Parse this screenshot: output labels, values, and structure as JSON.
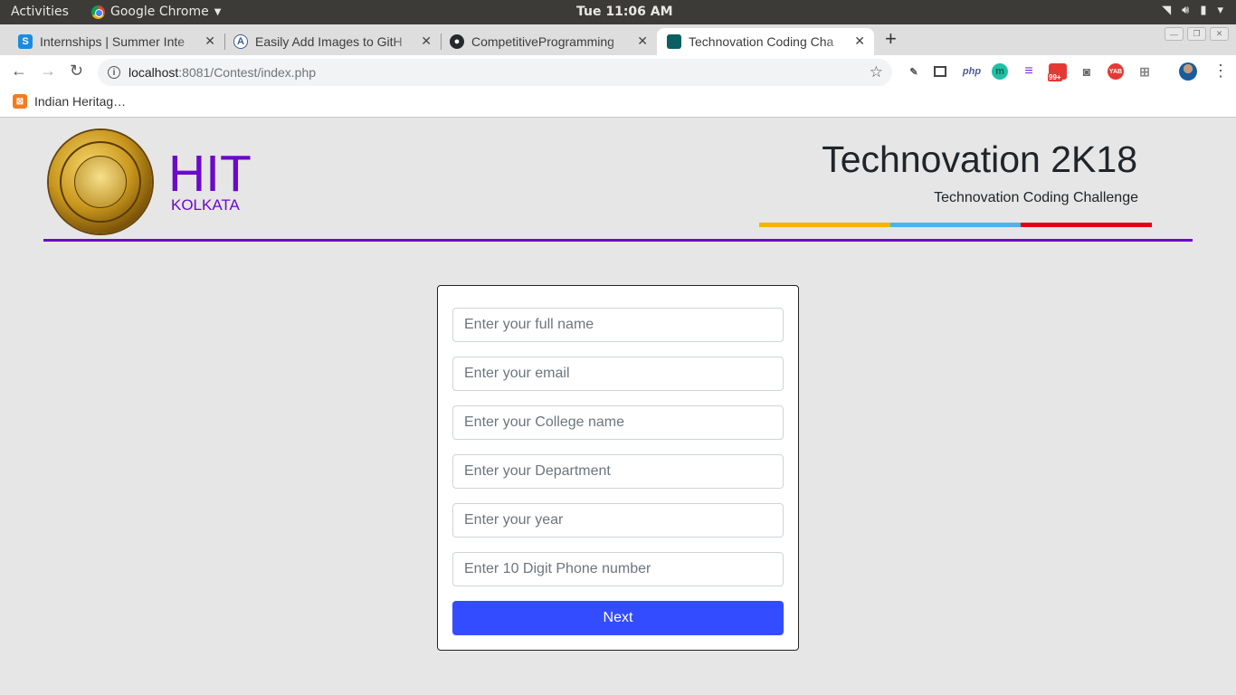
{
  "system_bar": {
    "activities": "Activities",
    "app_name": "Google Chrome",
    "clock": "Tue 11:06 AM",
    "icons": [
      "wifi-icon",
      "volume-icon",
      "battery-icon",
      "chevron-down-icon"
    ]
  },
  "tabs": [
    {
      "title": "Internships | Summer Inte",
      "favicon": "internshala-icon",
      "color": "#1a8be0"
    },
    {
      "title": "Easily Add Images to GitH",
      "favicon": "font-a-icon",
      "color": "#3b5998"
    },
    {
      "title": "CompetitiveProgramming",
      "favicon": "github-icon",
      "color": "#24292e"
    },
    {
      "title": "Technovation Coding Cha",
      "favicon": "site-icon",
      "color": "#0b5f63",
      "active": true
    }
  ],
  "address_bar": {
    "host": "localhost",
    "path": ":8081/Contest/index.php"
  },
  "extensions": [
    "eyedropper-icon",
    "screenshot-icon",
    "php-icon",
    "m-icon",
    "menu-lines-icon",
    "badge-icon",
    "camera-icon",
    "yab-icon",
    "cart-icon",
    "profile-avatar"
  ],
  "extension_labels": {
    "php": "php",
    "badge": "99+",
    "yab": "YAB",
    "m": "m"
  },
  "bookmarks": [
    {
      "label": "Indian Heritag…",
      "favicon": "bookmark-icon"
    }
  ],
  "header": {
    "brand": "HIT",
    "brand_sub": "KOLKATA",
    "event_title": "Technovation 2K18",
    "event_subtitle": "Technovation Coding Challenge",
    "brand_color": "#6b0ac9",
    "stripe_colors": [
      "#f5b400",
      "#4db3ea",
      "#e60012"
    ]
  },
  "form": {
    "full_name_placeholder": "Enter your full name",
    "email_placeholder": "Enter your email",
    "college_placeholder": "Enter your College name",
    "department_placeholder": "Enter your Department",
    "year_placeholder": "Enter your year",
    "phone_placeholder": "Enter 10 Digit Phone number",
    "next_label": "Next",
    "button_color": "#334cff"
  }
}
